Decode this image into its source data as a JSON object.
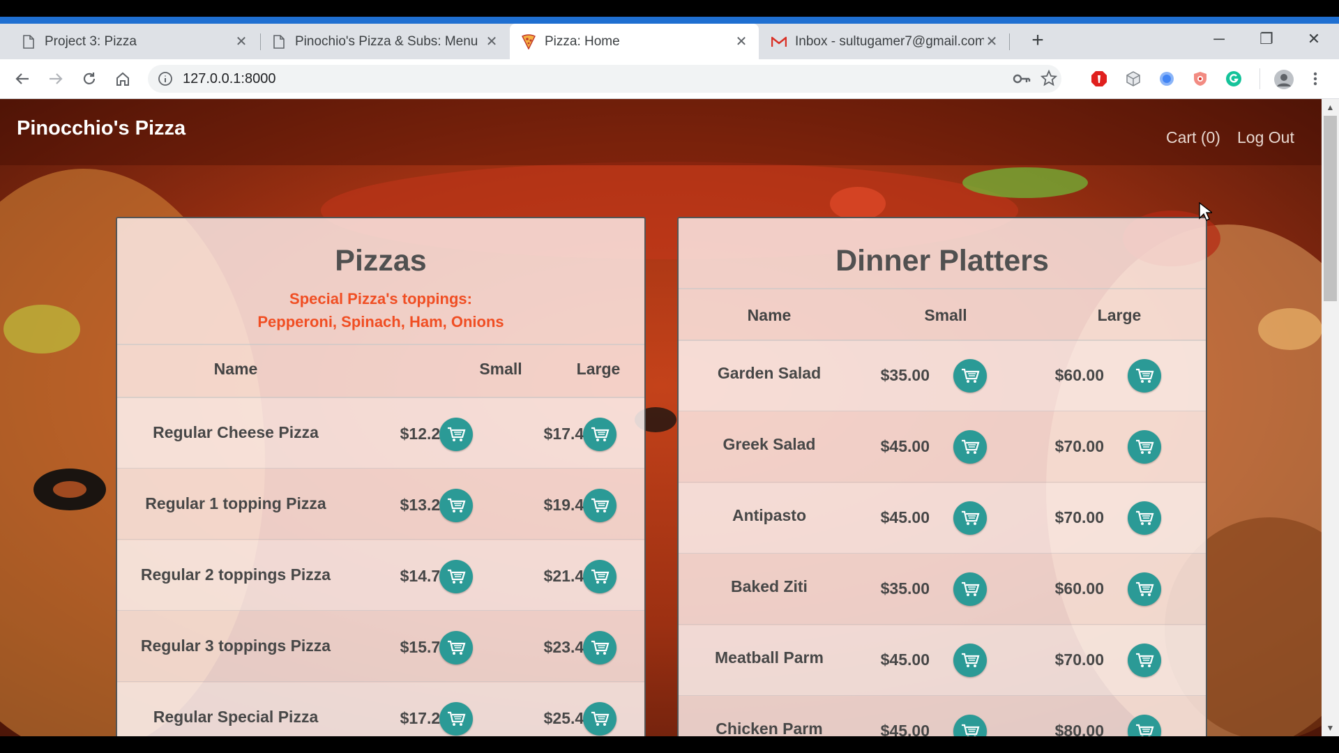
{
  "tabs": [
    {
      "title": "Project 3: Pizza",
      "icon": "page-icon",
      "active": false
    },
    {
      "title": "Pinochio's Pizza & Subs: Menu",
      "icon": "page-icon",
      "active": false
    },
    {
      "title": "Pizza: Home",
      "icon": "pizza-icon",
      "active": true
    },
    {
      "title": "Inbox - sultugamer7@gmail.com",
      "icon": "gmail-icon",
      "active": false
    }
  ],
  "browser": {
    "url": "127.0.0.1:8000",
    "new_tab": "+",
    "minimize": "─",
    "restore": "❐",
    "close": "✕"
  },
  "site": {
    "brand": "Pinocchio's Pizza",
    "nav": {
      "cart": "Cart (0)",
      "logout": "Log Out"
    }
  },
  "pizzas": {
    "title": "Pizzas",
    "special_line1": "Special Pizza's toppings:",
    "special_line2": "Pepperoni, Spinach, Ham, Onions",
    "headers": {
      "name": "Name",
      "small": "Small",
      "large": "Large"
    },
    "rows": [
      {
        "name": "Regular Cheese Pizza",
        "small": "$12.20",
        "large": "$17.45"
      },
      {
        "name": "Regular 1 topping Pizza",
        "small": "$13.20",
        "large": "$19.45"
      },
      {
        "name": "Regular 2 toppings Pizza",
        "small": "$14.70",
        "large": "$21.45"
      },
      {
        "name": "Regular 3 toppings Pizza",
        "small": "$15.70",
        "large": "$23.45"
      },
      {
        "name": "Regular Special Pizza",
        "small": "$17.25",
        "large": "$25.45"
      }
    ]
  },
  "platters": {
    "title": "Dinner Platters",
    "headers": {
      "name": "Name",
      "small": "Small",
      "large": "Large"
    },
    "rows": [
      {
        "name": "Garden Salad",
        "small": "$35.00",
        "large": "$60.00"
      },
      {
        "name": "Greek Salad",
        "small": "$45.00",
        "large": "$70.00"
      },
      {
        "name": "Antipasto",
        "small": "$45.00",
        "large": "$70.00"
      },
      {
        "name": "Baked Ziti",
        "small": "$35.00",
        "large": "$60.00"
      },
      {
        "name": "Meatball Parm",
        "small": "$45.00",
        "large": "$70.00"
      },
      {
        "name": "Chicken Parm",
        "small": "$45.00",
        "large": "$80.00"
      }
    ]
  },
  "colors": {
    "accent_teal": "#2b9a96",
    "special_orange": "#f04e23",
    "chrome_blue": "#1f6fd1"
  }
}
